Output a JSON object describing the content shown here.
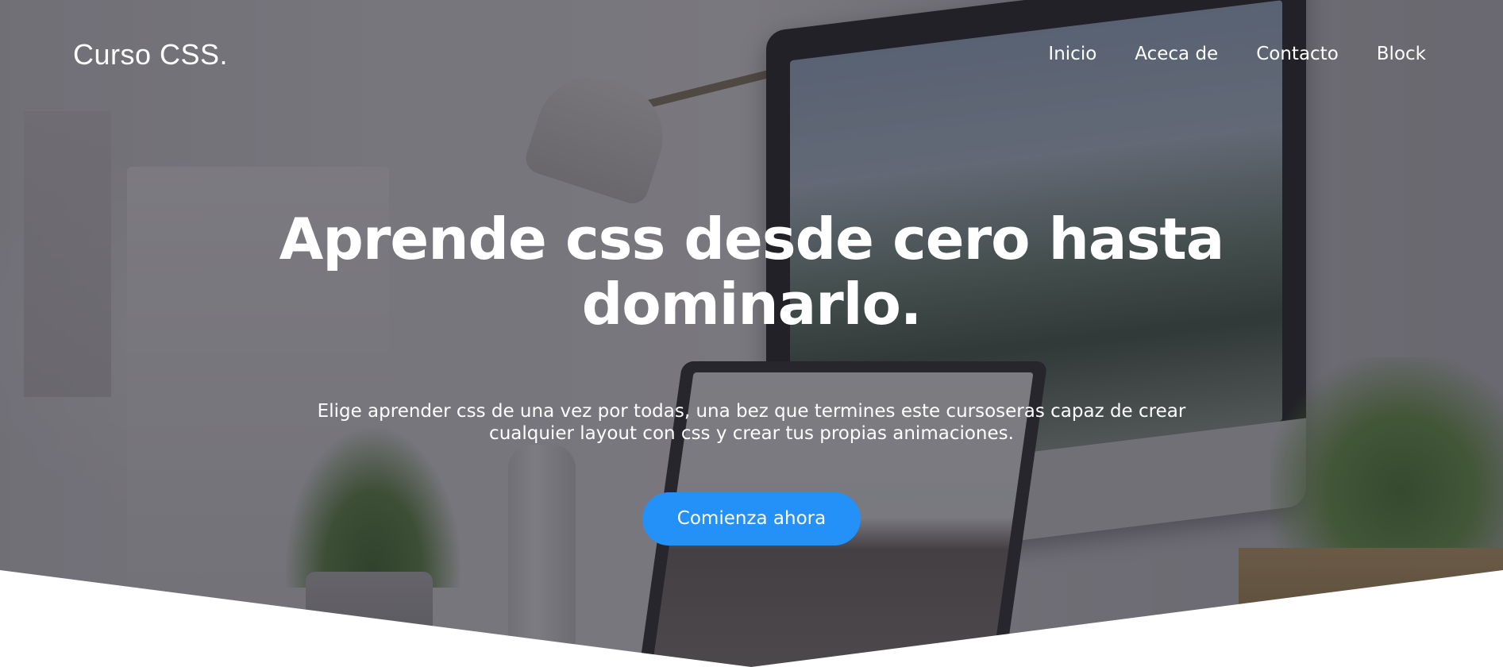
{
  "header": {
    "logo": "Curso CSS.",
    "nav": [
      "Inicio",
      "Aceca de",
      "Contacto",
      "Block"
    ]
  },
  "hero": {
    "title": "Aprende css desde cero hasta dominarlo.",
    "subtitle": "Elige aprender css de una vez por todas, una bez que termines este cursoseras capaz de crear cualquier layout con css y crear tus propias animaciones.",
    "cta_label": "Comienza ahora"
  },
  "colors": {
    "accent": "#2491f9",
    "overlay": "rgba(38,36,45,0.58)",
    "text": "#ffffff"
  }
}
